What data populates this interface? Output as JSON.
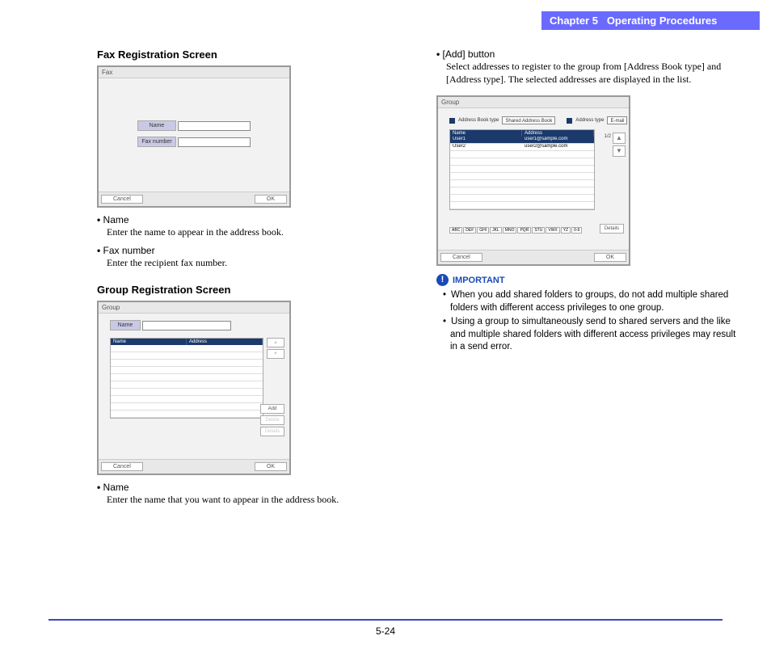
{
  "header": {
    "chapter": "Chapter 5",
    "title": "Operating Procedures"
  },
  "footer": {
    "page_number": "5-24"
  },
  "left": {
    "fax": {
      "heading": "Fax Registration Screen",
      "dialog": {
        "title": "Fax",
        "name_label": "Name",
        "fax_label": "Fax number",
        "cancel": "Cancel",
        "ok": "OK"
      },
      "items": [
        {
          "label": "Name",
          "desc": "Enter the name to appear in the address book."
        },
        {
          "label": "Fax number",
          "desc": "Enter the recipient fax number."
        }
      ]
    },
    "group": {
      "heading": "Group Registration Screen",
      "dialog": {
        "title": "Group",
        "name_label": "Name",
        "th_name": "Name",
        "th_addr": "Address",
        "add": "Add",
        "delete": "Delete",
        "details": "Details",
        "cancel": "Cancel",
        "ok": "OK"
      },
      "items": [
        {
          "label": "Name",
          "desc": "Enter the name that you want to appear in the address book."
        }
      ]
    }
  },
  "right": {
    "add": {
      "label": "[Add] button",
      "desc": "Select addresses to register to the group from [Address Book type] and [Address type]. The selected addresses are displayed in the list."
    },
    "dialog": {
      "title": "Group",
      "abt_label": "Address Book type",
      "abt_value": "Shared Address Book",
      "at_label": "Address type",
      "at_value": "E-mail",
      "th_name": "Name",
      "th_addr": "Address",
      "page_ind": "1/2",
      "rows": [
        {
          "name": "User1",
          "addr": "user1@sample.com"
        },
        {
          "name": "User2",
          "addr": "user2@sample.com"
        }
      ],
      "alpha": [
        "ABC",
        "DEF",
        "GHI",
        "JKL",
        "MNO",
        "PQR",
        "STU",
        "VWX",
        "YZ",
        "0-9"
      ],
      "details": "Details",
      "cancel": "Cancel",
      "ok": "OK"
    },
    "important": {
      "label": "IMPORTANT",
      "bullets": [
        "When you add shared folders to groups, do not add multiple shared folders with different access privileges to one group.",
        "Using a group to simultaneously send to shared servers and the like and multiple shared folders with different access privileges may result in a send error."
      ]
    }
  }
}
